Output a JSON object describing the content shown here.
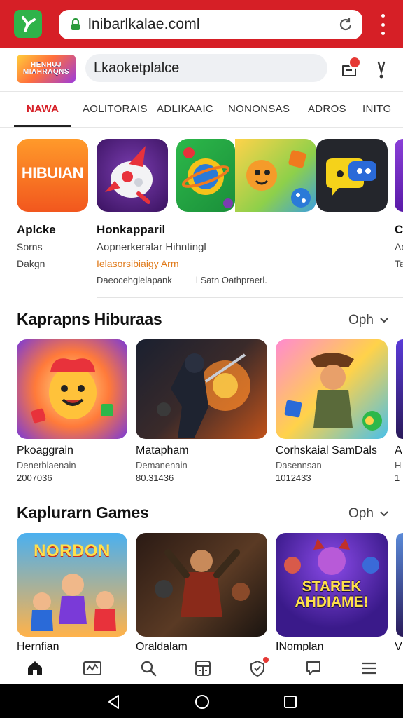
{
  "browser": {
    "url": "lnibarlkalae.coml"
  },
  "header": {
    "logo_text": "HENHUJ MIAHRAQNS",
    "search_value": "Lkaoketplalce"
  },
  "tabs": [
    {
      "label": "NAWA"
    },
    {
      "label": "AOLITORAIS"
    },
    {
      "label": "ADLIKAAIC"
    },
    {
      "label": "NONONSAS"
    },
    {
      "label": "ADROS"
    },
    {
      "label": "INITG"
    }
  ],
  "featured": {
    "tile1_text": "HIBUIAN",
    "app1": {
      "name": "Aplcke",
      "sub1": "Sorns",
      "sub2": "Dakgn"
    },
    "app2": {
      "name": "Honkapparil",
      "desc": "Aopnerkeralar Hihntingl",
      "accent": "Ielasorsibiaigy Arm",
      "meta_left": "Daeocehglelapank",
      "meta_right": "l Satn Oathpraerl."
    },
    "app3_initial": "C",
    "app3_sub1": "Ac",
    "app3_sub2": "Ta"
  },
  "section1": {
    "title": "Kaprapns Hiburaas",
    "see_all": "Oph",
    "cards": [
      {
        "title": "Pkoaggrain",
        "sub": "Denerblaenain",
        "num": "2007036"
      },
      {
        "title": "Matapham",
        "sub": "Demanenain",
        "num": "80.31436"
      },
      {
        "title": "Corhskaial SamDals",
        "sub": "Dasennsan",
        "num": "1012433"
      },
      {
        "title": "A",
        "sub": "H",
        "num": "1"
      }
    ]
  },
  "section2": {
    "title": "Kaplurarn Games",
    "see_all": "Oph",
    "cards": [
      {
        "title": "Hernfian",
        "art_text": "NORDON"
      },
      {
        "title": "Oraldalam",
        "art_text": ""
      },
      {
        "title": "INomplan",
        "art_text": "STAREK AHDIAME!"
      },
      {
        "title": "V",
        "art_text": ""
      }
    ]
  },
  "bottom_nav": [
    {
      "icon": "home-icon"
    },
    {
      "icon": "chart-icon"
    },
    {
      "icon": "search-icon"
    },
    {
      "icon": "calculator-icon"
    },
    {
      "icon": "shield-icon"
    },
    {
      "icon": "chat-icon"
    },
    {
      "icon": "menu-icon"
    }
  ],
  "colors": {
    "brand_red": "#d61f26",
    "accent_orange": "#e07a1a",
    "nav_badge": "#e53935"
  }
}
